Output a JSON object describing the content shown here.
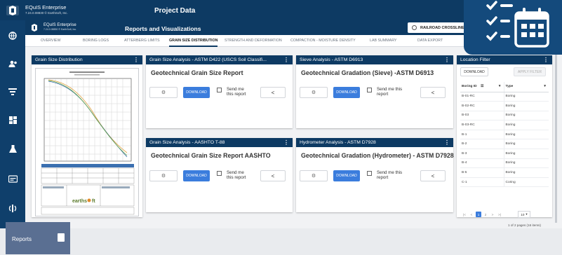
{
  "app": {
    "brand": "EQuIS Enterprise",
    "brand_sub": "7.24.0.08830 © EarthSoft, Inc.",
    "page_title": "Project Data"
  },
  "inner": {
    "brand": "EQuIS Enterprise",
    "brand_sub": "7.24.0.08830 © EarthSoft, Inc.",
    "title": "Reports and Visualizations",
    "site": "RAILROAD CROSSLINE"
  },
  "tabs": [
    {
      "label": "OVERVIEW"
    },
    {
      "label": "BORING LOGS"
    },
    {
      "label": "ATTERBERG LIMITS"
    },
    {
      "label": "GRAIN SIZE DISTRIBUTION"
    },
    {
      "label": "STRENGTH AND DEFORMATION"
    },
    {
      "label": "COMPACTION - MOISTURE DENSITY"
    },
    {
      "label": "LAB SUMMARY"
    },
    {
      "label": "DATA EXPORT"
    }
  ],
  "rail_icons": [
    "globe-icon",
    "users-icon",
    "filter-icon",
    "dashboard-icon",
    "flask-icon",
    "form-icon",
    "broadcast-icon"
  ],
  "grain_panel": {
    "title": "Grain Size Distribution",
    "thumb_footer": "earthsoft"
  },
  "report_cards": [
    {
      "header": "Grain Size Analysis - ASTM D422 (USCS Soil Classifi...",
      "title": "Geotechnical Grain Size Report",
      "download": "DOWNLOAD",
      "send": "Send me\nthis report"
    },
    {
      "header": "Sieve Analysis - ASTM D6913",
      "title": "Geotechnical Gradation (Sieve) -ASTM D6913",
      "download": "DOWNLOAD",
      "send": "Send me this\nreport"
    },
    {
      "header": "Grain Size Analysis - AASHTO T-88",
      "title": "Geotechnical Grain Size Report AASHTO",
      "download": "DOWNLOAD",
      "send": "Send me\nthis report"
    },
    {
      "header": "Hydrometer Analysis - ASTM D7928",
      "title": "Geotechnical Gradation (Hydrometer) - ASTM D7928",
      "download": "DOWNLOAD",
      "send": "Send me this\nreport"
    }
  ],
  "location_filter": {
    "title": "Location Filter",
    "download": "DOWNLOAD",
    "apply": "APPLY FILTER",
    "col_id": "Boring ID",
    "col_type": "Type",
    "rows": [
      {
        "id": "B-01-RC",
        "type": "Boring"
      },
      {
        "id": "B-02-RC",
        "type": "Boring"
      },
      {
        "id": "B-03",
        "type": "Boring"
      },
      {
        "id": "B-03-RC",
        "type": "Boring"
      },
      {
        "id": "B-1",
        "type": "Boring"
      },
      {
        "id": "B-2",
        "type": "Boring"
      },
      {
        "id": "B-3",
        "type": "Boring"
      },
      {
        "id": "B-4",
        "type": "Boring"
      },
      {
        "id": "B-5",
        "type": "Boring"
      },
      {
        "id": "C-1",
        "type": "Coring"
      }
    ],
    "pages": [
      "1",
      "2"
    ],
    "page_size": "10",
    "page_info": "1 of 2 pages (16 items)"
  },
  "reports": {
    "label": "Reports"
  },
  "colors": {
    "nav": "#0d3a63",
    "rail": "#0f3f6b",
    "accent": "#3b7ddd"
  }
}
